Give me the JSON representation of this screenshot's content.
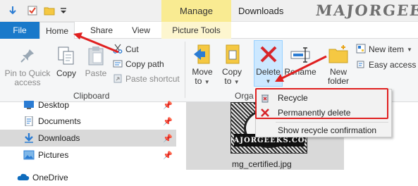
{
  "titlebar": {
    "context_tab": "Manage",
    "window_title": "Downloads",
    "watermark": "MAJORGEEKS",
    "quick_access_icons": [
      "explorer-back-icon",
      "properties-check-icon",
      "new-folder-icon",
      "customize-dropdown-icon"
    ]
  },
  "tabs": [
    "File",
    "Home",
    "Share",
    "View",
    "Picture Tools"
  ],
  "ribbon": {
    "clipboard": {
      "group_label": "Clipboard",
      "pin_label_line1": "Pin to Quick",
      "pin_label_line2": "access",
      "copy_label": "Copy",
      "paste_label": "Paste",
      "cut_label": "Cut",
      "copy_path_label": "Copy path",
      "paste_shortcut_label": "Paste shortcut"
    },
    "organize": {
      "group_label": "Orga",
      "move_to_line1": "Move",
      "move_to_line2": "to",
      "copy_to_line1": "Copy",
      "copy_to_line2": "to",
      "delete_label": "Delete",
      "rename_label": "Rename"
    },
    "new": {
      "new_folder_line1": "New",
      "new_folder_line2": "folder",
      "new_item_label": "New item",
      "easy_access_label": "Easy access"
    }
  },
  "nav": {
    "items": [
      {
        "label": "Desktop",
        "icon": "desktop-icon",
        "pinned": true,
        "selected": false
      },
      {
        "label": "Documents",
        "icon": "documents-icon",
        "pinned": true,
        "selected": false
      },
      {
        "label": "Downloads",
        "icon": "downloads-icon",
        "pinned": true,
        "selected": true
      },
      {
        "label": "Pictures",
        "icon": "pictures-icon",
        "pinned": true,
        "selected": false
      },
      {
        "label": "OneDrive",
        "icon": "onedrive-icon",
        "pinned": false,
        "selected": false
      }
    ]
  },
  "content": {
    "file_name": "mg_certified.jpg",
    "thumbnail_text": "MAJORGEEKS.COM"
  },
  "delete_menu": {
    "items": [
      {
        "label": "Recycle",
        "icon": "recycle-bin-icon"
      },
      {
        "label": "Permanently delete",
        "icon": "red-x-icon"
      },
      {
        "label": "Show recycle confirmation",
        "icon": ""
      }
    ]
  },
  "colors": {
    "file_tab": "#1979ca",
    "context_tab": "#f9eb92",
    "annotation_red": "#e02020",
    "selection_blue": "#cce8ff"
  }
}
